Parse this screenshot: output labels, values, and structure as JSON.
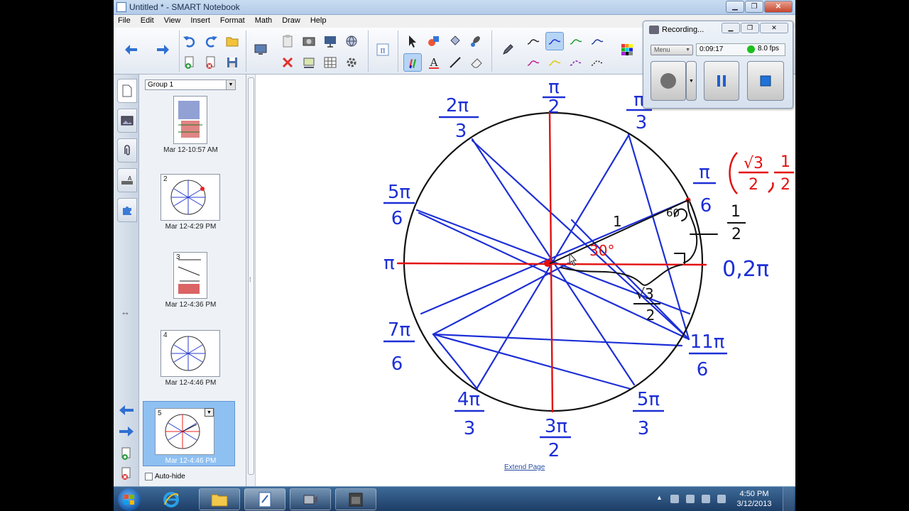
{
  "window": {
    "title": "Untitled * - SMART Notebook"
  },
  "menu": [
    "File",
    "Edit",
    "View",
    "Insert",
    "Format",
    "Math",
    "Draw",
    "Help"
  ],
  "recorder": {
    "title": "Recording...",
    "menu_label": "Menu",
    "elapsed": "0:09:17",
    "fps": "8.0 fps"
  },
  "sorter": {
    "group": "Group 1",
    "pages": [
      {
        "num": "",
        "label": "Mar 12-10:57 AM"
      },
      {
        "num": "2",
        "label": "Mar 12-4:29 PM"
      },
      {
        "num": "3",
        "label": "Mar 12-4:36 PM"
      },
      {
        "num": "4",
        "label": "Mar 12-4:46 PM"
      },
      {
        "num": "5",
        "label": "Mar 12-4:46 PM"
      }
    ],
    "autohide": "Auto-hide"
  },
  "canvas": {
    "extend_link": "Extend Page",
    "angle_labels": {
      "pi_over_2": {
        "num": "π",
        "den": "2"
      },
      "pi_over_3": {
        "num": "π",
        "den": "3"
      },
      "two_pi_over_3": {
        "num": "2π",
        "den": "3"
      },
      "pi_over_6": {
        "num": "π",
        "den": "6"
      },
      "five_pi_over_6": {
        "num": "5π",
        "den": "6"
      },
      "pi": "π",
      "zero_two_pi": "0,2π",
      "seven_pi_over_6": {
        "num": "7π",
        "den": "6"
      },
      "eleven_pi_over_6": {
        "num": "11π",
        "den": "6"
      },
      "four_pi_over_3": {
        "num": "4π",
        "den": "3"
      },
      "five_pi_over_3": {
        "num": "5π",
        "den": "3"
      },
      "three_pi_over_2": {
        "num": "3π",
        "den": "2"
      }
    },
    "annotations": {
      "point_label": {
        "x_num": "√3",
        "x_den": "2",
        "y_num": "1",
        "y_den": "2"
      },
      "hypotenuse": "1",
      "angle_30": "30°",
      "angle_60": "60",
      "opposite_num": "1",
      "opposite_den": "2",
      "adjacent_num": "√3",
      "adjacent_den": "2"
    }
  },
  "taskbar": {
    "time": "4:50 PM",
    "date": "3/12/2013"
  },
  "colors": {
    "ink_blue": "#1d2fd6",
    "ink_red": "#e31010",
    "ink_black": "#111111"
  }
}
